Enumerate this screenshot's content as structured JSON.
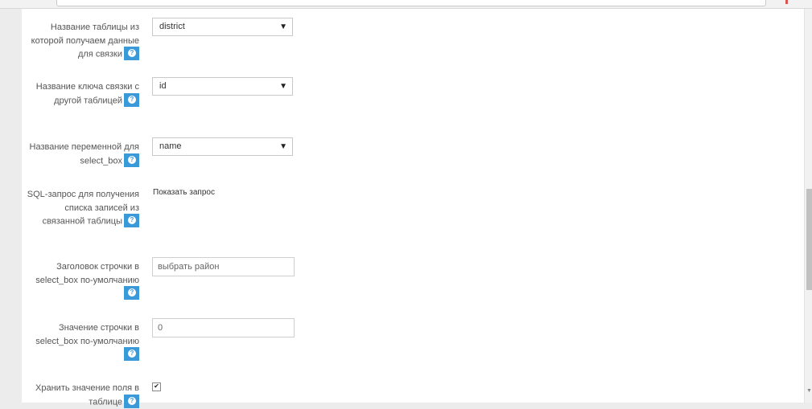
{
  "fields": [
    {
      "label": "Название таблицы из которой получаем данные для связки",
      "type": "select",
      "value": "district"
    },
    {
      "label": "Название ключа связки с другой таблицей",
      "type": "select",
      "value": "id"
    },
    {
      "label": "Название переменной для select_box",
      "type": "select",
      "value": "name"
    },
    {
      "label": "SQL-запрос для получения списка записей из связанной таблицы",
      "type": "link",
      "value": "Показать запрос"
    },
    {
      "label": "Заголовок строчки в select_box по-умолчанию",
      "type": "input",
      "value": "выбрать район"
    },
    {
      "label": "Значение строчки в select_box по-умолчанию",
      "type": "input",
      "value": "0"
    },
    {
      "label": "Хранить значение поля в таблице",
      "type": "checkbox",
      "checked": true
    }
  ],
  "icons": {
    "help": "question-circle-icon",
    "caret": "caret-down-icon",
    "check": "checkmark-icon"
  },
  "colors": {
    "help_bg": "#3a9ad9",
    "panel_bg": "#ffffff",
    "page_bg": "#ececec"
  }
}
